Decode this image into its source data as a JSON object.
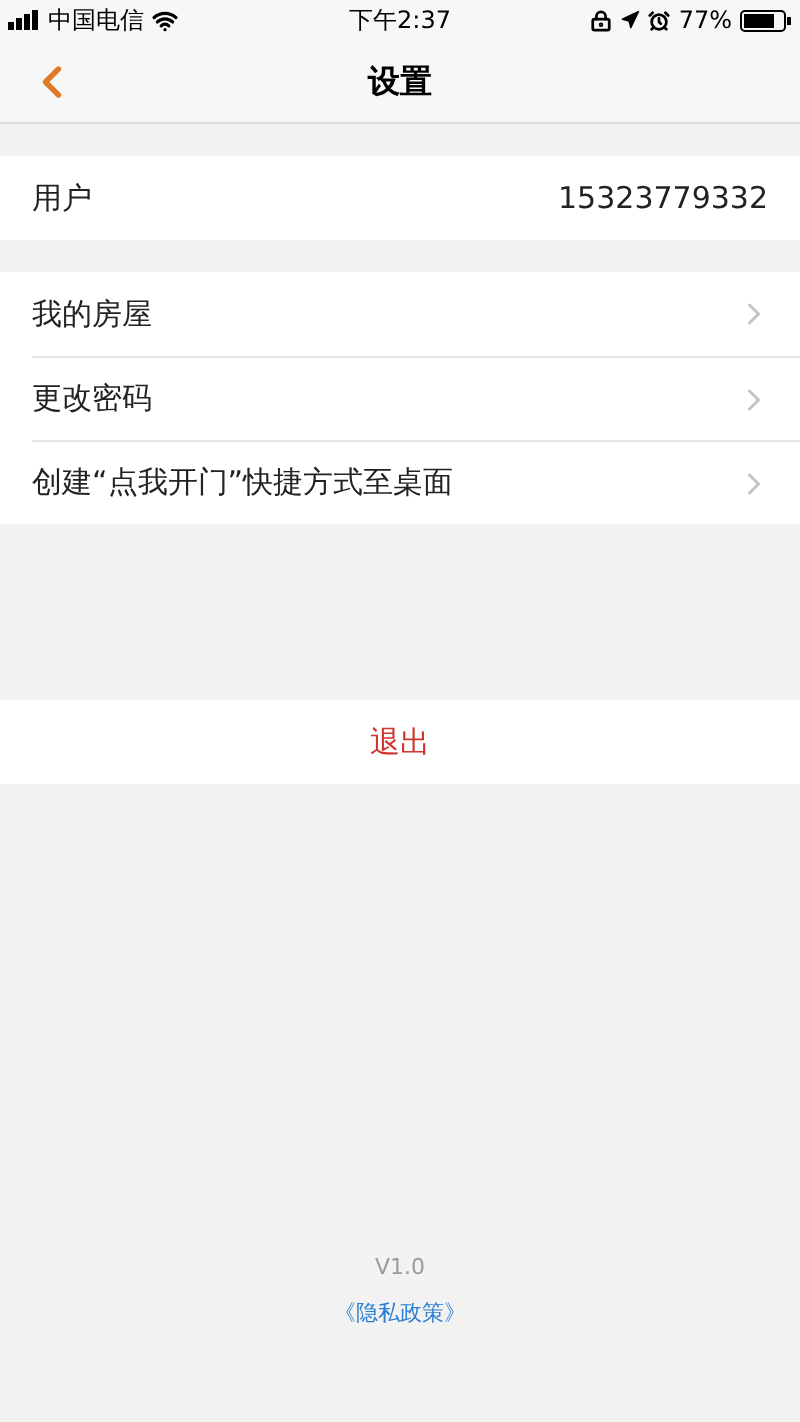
{
  "status_bar": {
    "carrier": "中国电信",
    "time": "下午2:37",
    "battery": "77%"
  },
  "nav": {
    "title": "设置"
  },
  "user": {
    "label": "用户",
    "value": "15323779332"
  },
  "menu": [
    {
      "label": "我的房屋"
    },
    {
      "label": "更改密码"
    },
    {
      "label": "创建“点我开门”快捷方式至桌面"
    }
  ],
  "logout": "退出",
  "footer": {
    "version": "V1.0",
    "policy_link": "《隐私政策》"
  }
}
